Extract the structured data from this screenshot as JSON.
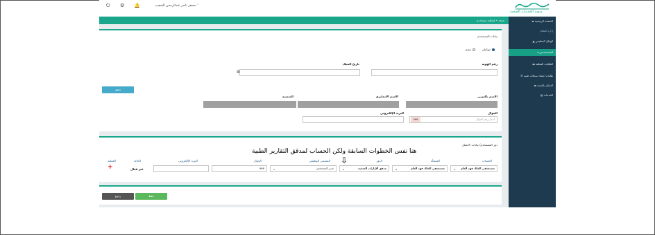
{
  "header": {
    "user_name": "مسفر ناصر عبدالرحمن الشعيب",
    "user_caret": "˅",
    "logo_text": "صحة",
    "logo_subtitle": "منصة الخدمات الصحية"
  },
  "breadcrumb": {
    "text": "صحة  •  إضافة مستخدم"
  },
  "sidebar": {
    "items": [
      {
        "label": "الصفحة الرئيسية"
      },
      {
        "label": "إدارة النظام"
      },
      {
        "label": "الهيكل التنظيمي"
      },
      {
        "label": "المستخدمين"
      },
      {
        "label": "الطلبات المعلقة"
      },
      {
        "label": "طلبات اعتماد سجلات طبية"
      },
      {
        "label": "التحكم بالصحة"
      },
      {
        "label": "الخدمات"
      }
    ]
  },
  "form": {
    "section_title": "بيانات المستخدم",
    "radio_citizen": "مواطن",
    "radio_resident": "مقيم",
    "id_label": "رقم الهوية",
    "dob_label": "تاريخ الميلاد",
    "verify_button": "تحقق",
    "full_name_label": "الاسم بالعربي",
    "english_name_label": "الاسم الانجليزي",
    "nationality_label": "الجنسية",
    "mobile_label": "الجوال",
    "mobile_placeholder": "أدخل رقم الجوال",
    "mobile_prefix": "966",
    "email_label": "البريد الإلكتروني"
  },
  "roles": {
    "section_title": "دور المستخدم/ بيانات الاتصال",
    "annotation": "هنا نفس الخطوات السابقة ولكن الحساب  لمدقق التقارير الطبية",
    "arrow": "⇩",
    "columns": [
      "الحساب",
      "المنشأة",
      "الدور",
      "المسمى الوظيفي",
      "الجوال",
      "البريد الإلكتروني",
      "الحالة",
      "العملية"
    ],
    "row": {
      "account": "مستشفى الملك فهد العام",
      "facility": "مستشفى الملك فهد العام",
      "role": "مدقق الإدارات الصحية",
      "job_title": "مدير المستشفى",
      "mobile": "966",
      "email": "",
      "status": "غير فعال",
      "action": "+"
    }
  },
  "footer": {
    "save_button": "حفظ",
    "cancel_button": "رجوع"
  },
  "colors": {
    "accent": "#19a68b",
    "sidebar": "#1e3a4f",
    "annotation_text": "#000000"
  }
}
